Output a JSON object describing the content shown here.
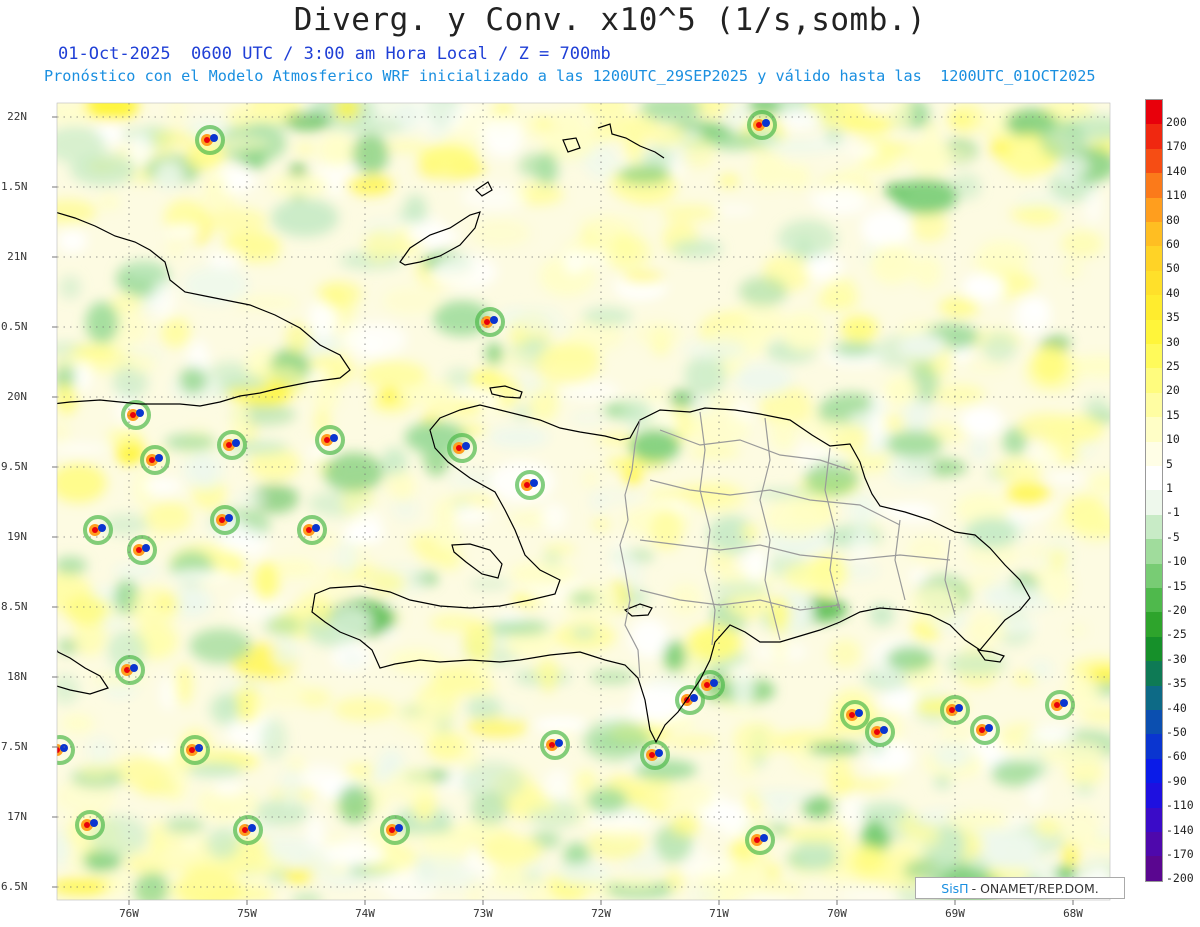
{
  "header": {
    "title": "Diverg. y Conv. x10^5 (1/s,somb.)",
    "subtitle_line1": "01-Oct-2025  0600 UTC / 3:00 am Hora Local / Z = 700mb",
    "subtitle_line2": "Pronóstico con el Modelo Atmosferico WRF inicializado a las 1200UTC_29SEP2025 y válido hasta las  1200UTC_01OCT2025"
  },
  "axes": {
    "lat_labels": [
      "22N",
      "1.5N",
      "21N",
      "0.5N",
      "20N",
      "9.5N",
      "19N",
      "8.5N",
      "18N",
      "7.5N",
      "17N",
      "6.5N"
    ],
    "lat_values": [
      22,
      21.5,
      21,
      20.5,
      20,
      19.5,
      19,
      18.5,
      18,
      17.5,
      17,
      16.5
    ],
    "lon_labels": [
      "76W",
      "75W",
      "74W",
      "73W",
      "72W",
      "71W",
      "70W",
      "69W",
      "68W"
    ],
    "lon_values": [
      -76,
      -75,
      -74,
      -73,
      -72,
      -71,
      -70,
      -69,
      -68
    ]
  },
  "colorbar": {
    "labels": [
      "200",
      "170",
      "140",
      "110",
      "80",
      "60",
      "50",
      "40",
      "35",
      "30",
      "25",
      "20",
      "15",
      "10",
      "5",
      "1",
      "-1",
      "-5",
      "-10",
      "-15",
      "-20",
      "-25",
      "-30",
      "-35",
      "-40",
      "-50",
      "-60",
      "-90",
      "-110",
      "-140",
      "-170",
      "-200"
    ],
    "colors": [
      "#e8000b",
      "#f02810",
      "#f64d14",
      "#fb7a1a",
      "#ff9e1e",
      "#ffbe22",
      "#ffd326",
      "#ffe02a",
      "#ffec2e",
      "#fff53a",
      "#fffa5a",
      "#fffc7e",
      "#fffda2",
      "#fffec6",
      "#fffee6",
      "#ffffff",
      "#eef8ec",
      "#c8ebc6",
      "#a0dc9c",
      "#78cc74",
      "#4fb94c",
      "#2ea42c",
      "#16902a",
      "#0e7a55",
      "#0d6a86",
      "#0b4fb0",
      "#0a35d0",
      "#0a1be8",
      "#1e10e0",
      "#3a0bc8",
      "#4e08ac",
      "#5a0690"
    ]
  },
  "map": {
    "background_color": "#fdfbe2",
    "coast_color": "#000000",
    "border_color": "#9a9a9a"
  },
  "credit": {
    "logo": "SisΠ",
    "text": "- ONAMET/REP.DOM."
  }
}
